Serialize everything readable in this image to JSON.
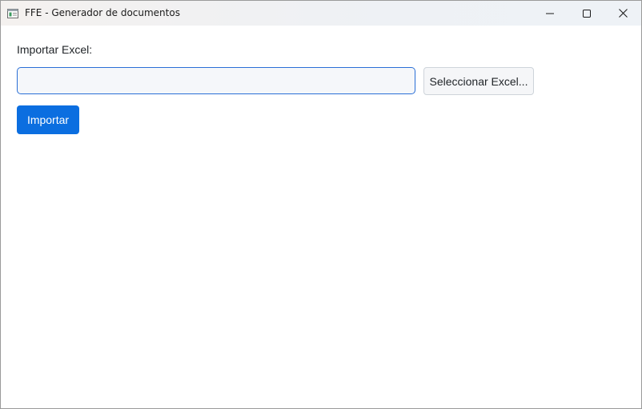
{
  "window": {
    "title": "FFE - Generador de documentos",
    "app_icon": "app-window-icon",
    "controls": {
      "minimize_icon": "minimize-icon",
      "maximize_icon": "maximize-icon",
      "close_icon": "close-icon"
    }
  },
  "form": {
    "import_label": "Importar Excel:",
    "file_input": {
      "value": "",
      "placeholder": ""
    },
    "select_button_label": "Seleccionar Excel...",
    "import_button_label": "Importar"
  },
  "colors": {
    "primary": "#0b6ee0",
    "input_border_focus": "#2a6fd6",
    "text": "#212529"
  }
}
